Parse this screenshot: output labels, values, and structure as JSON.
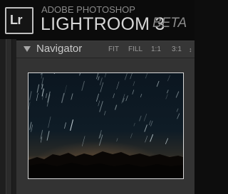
{
  "branding": {
    "logo_text": "Lr",
    "product_line": "ADOBE PHOTOSHOP",
    "app_name": "LIGHTROOM 3",
    "release_tag": "BETA"
  },
  "navigator": {
    "title": "Navigator",
    "zoom_options": [
      "FIT",
      "FILL",
      "1:1",
      "3:1"
    ],
    "caret_icon": "chevron-down-icon",
    "preview": {
      "description_icon": "star-trails-photo",
      "sky_color": "#0e1a24",
      "horizon_glow": "#a07448",
      "mountain_color": "#0a0806"
    }
  },
  "colors": {
    "background": "#0b0b0b",
    "panel": "#333333",
    "panel_header": "#363636",
    "text_primary": "#d6d6d6",
    "text_secondary": "#8a8a8a"
  }
}
